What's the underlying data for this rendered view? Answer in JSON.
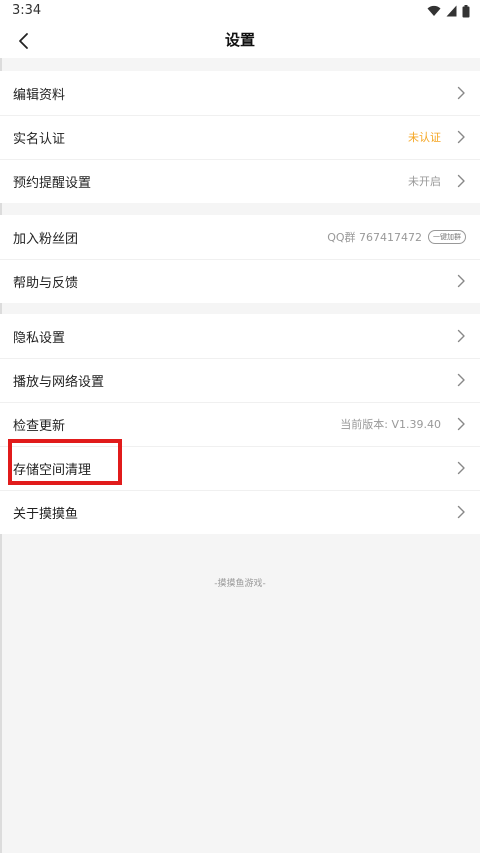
{
  "status_bar": {
    "time": "3:34",
    "icons": [
      "wifi-icon",
      "signal-icon",
      "battery-icon"
    ]
  },
  "header": {
    "title": "设置",
    "back_icon": "chevron-left-icon"
  },
  "groups": [
    {
      "rows": [
        {
          "label": "编辑资料",
          "value": "",
          "trailing": "chevron"
        },
        {
          "label": "实名认证",
          "value": "未认证",
          "value_color": "#f5a623",
          "trailing": "chevron"
        },
        {
          "label": "预约提醒设置",
          "value": "未开启",
          "trailing": "chevron"
        }
      ]
    },
    {
      "rows": [
        {
          "label": "加入粉丝团",
          "value": "QQ群 767417472",
          "trailing": "pill",
          "pill_text": "一键加群"
        },
        {
          "label": "帮助与反馈",
          "value": "",
          "trailing": "chevron"
        }
      ]
    },
    {
      "rows": [
        {
          "label": "隐私设置",
          "value": "",
          "trailing": "chevron"
        },
        {
          "label": "播放与网络设置",
          "value": "",
          "trailing": "chevron"
        },
        {
          "label": "检查更新",
          "value": "当前版本: V1.39.40",
          "trailing": "chevron"
        },
        {
          "label": "存储空间清理",
          "value": "",
          "trailing": "chevron"
        },
        {
          "label": "关于摸摸鱼",
          "value": "",
          "trailing": "chevron"
        }
      ]
    }
  ],
  "footer": {
    "text": "-摸摸鱼游戏-"
  },
  "colors": {
    "accent": "#f5a623",
    "highlight": "#e11b1b",
    "background": "#f5f5f5"
  }
}
